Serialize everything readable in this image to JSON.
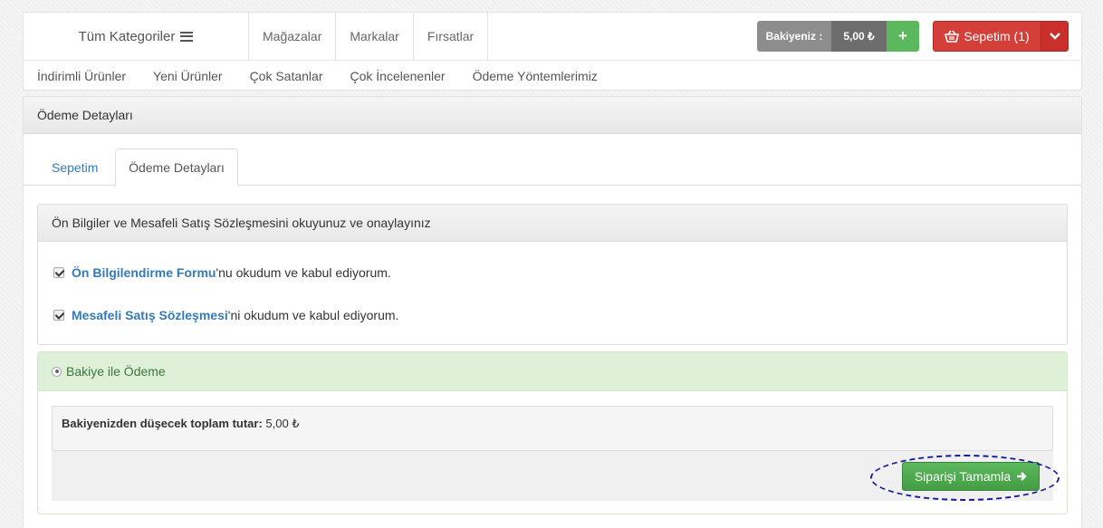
{
  "header": {
    "categories_label": "Tüm Kategoriler",
    "top_nav": [
      "Mağazalar",
      "Markalar",
      "Fırsatlar"
    ],
    "sub_nav": [
      "İndirimli Ürünler",
      "Yeni Ürünler",
      "Çok Satanlar",
      "Çok İncelenenler",
      "Ödeme Yöntemlerimiz"
    ],
    "balance_label": "Bakiyeniz :",
    "balance_value": "5,00 ₺",
    "add_balance_label": "+",
    "cart_label": "Sepetim (1)"
  },
  "panel": {
    "title": "Ödeme Detayları",
    "tabs": [
      "Sepetim",
      "Ödeme Detayları"
    ],
    "agreements": {
      "title": "Ön Bilgiler ve Mesafeli Satış Sözleşmesini okuyunuz ve onaylayınız",
      "items": [
        {
          "link": "Ön Bilgilendirme Formu",
          "text": "'nu okudum ve kabul ediyorum.",
          "checked": true
        },
        {
          "link": "Mesafeli Satış Sözleşmesi",
          "text": "'ni okudum ve kabul ediyorum.",
          "checked": true
        }
      ]
    },
    "payment": {
      "method_label": "Bakiye ile Ödeme",
      "total_label": "Bakiyenizden düşecek toplam tutar:",
      "total_value": " 5,00 ₺",
      "complete_label": "Siparişi Tamamla"
    }
  },
  "colors": {
    "link": "#337ab7",
    "success": "#5cb85c",
    "danger": "#d43f3a",
    "success_bg": "#dff0d8"
  }
}
